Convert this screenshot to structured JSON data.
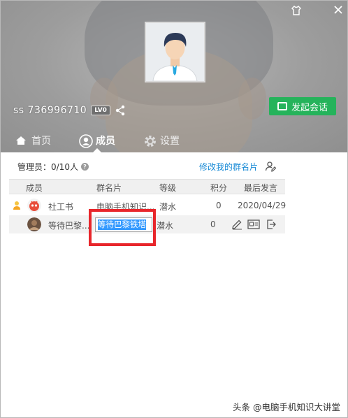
{
  "header": {
    "user_id": "ss 736996710",
    "level_badge": "LV0",
    "start_chat_label": "发起会话",
    "skin_icon": "shirt-icon",
    "close_icon": "close-icon"
  },
  "tabs": [
    {
      "label": "首页",
      "icon": "home-icon"
    },
    {
      "label": "成员",
      "icon": "member-icon"
    },
    {
      "label": "设置",
      "icon": "gear-icon"
    }
  ],
  "members": {
    "admin_label": "管理员：0/10人",
    "edit_card_link": "修改我的群名片",
    "columns": [
      "成员",
      "群名片",
      "等级",
      "积分",
      "最后发言"
    ],
    "rows": [
      {
        "member": "社工书",
        "card": "电脑手机知识...",
        "level": "潜水",
        "points": "0",
        "last_speak": "2020/04/29"
      },
      {
        "member": "等待巴黎...",
        "card_edit_value": "等待巴黎铁塔",
        "level": "潜水",
        "points": "0",
        "last_speak": ""
      }
    ]
  },
  "colors": {
    "accent_green": "#25b35b",
    "link_blue": "#1a8bd6",
    "highlight_red": "#e8262b",
    "selection_blue": "#3399ff"
  },
  "watermark": "头条 @电脑手机知识大讲堂"
}
